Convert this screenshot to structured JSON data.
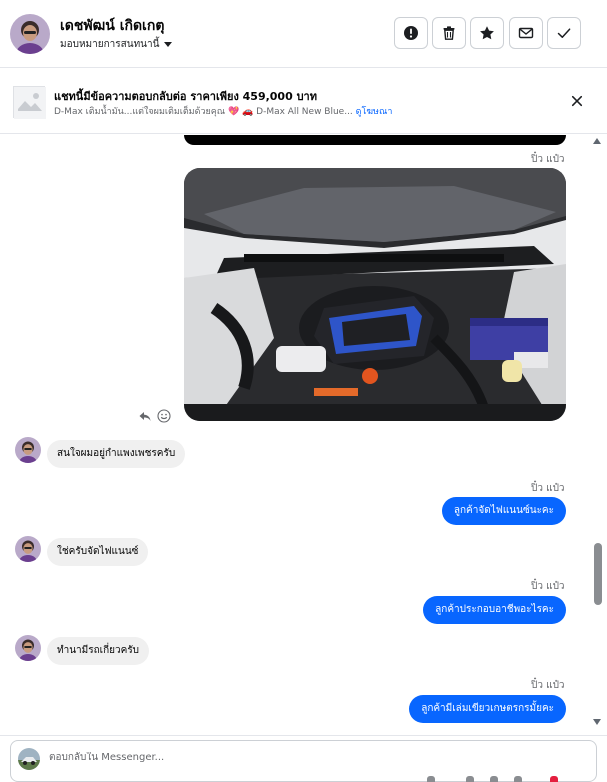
{
  "header": {
    "contact_name": "เดชพัฒน์ เกิดเกตุ",
    "assign_label": "มอบหมายการสนทนานี้",
    "buttons": [
      {
        "name": "report-button",
        "icon": "exclamation-icon"
      },
      {
        "name": "delete-button",
        "icon": "trash-icon"
      },
      {
        "name": "star-button",
        "icon": "star-icon"
      },
      {
        "name": "mark-unread-button",
        "icon": "envelope-icon"
      },
      {
        "name": "done-button",
        "icon": "check-icon"
      }
    ]
  },
  "ad_banner": {
    "title": "แชทนี้มีข้อความตอบกลับต่อ ราคาเพียง 459,000 บาท",
    "subtitle": "D-Max เติมน้ำมัน...แต่ใจผมเติมเต็มด้วยคุณ 💖 🚗 D-Max All New Blue...",
    "link_text": "ดูโฆษณา",
    "close_icon": "close-icon"
  },
  "messages": {
    "sender_label": "ปิ๋ว แป๋ว",
    "incoming": [
      "สนใจผมอยู่กำแพงเพชรครับ",
      "ใช่ครับจัดไฟแนนซ์",
      "ทำนามีรถเกี่ยวครับ"
    ],
    "outgoing": [
      "ลูกค้าจัดไฟแนนซ์นะคะ",
      "ลูกค้าประกอบอาชีพอะไรคะ",
      "ลูกค้ามีเล่มเขียวเกษตรกรมั้ยคะ"
    ]
  },
  "composer": {
    "placeholder": "ตอบกลับใน Messenger..."
  },
  "colors": {
    "accent": "#0866ff",
    "incoming_bubble": "#f0f0f0",
    "text_secondary": "#65676b"
  }
}
